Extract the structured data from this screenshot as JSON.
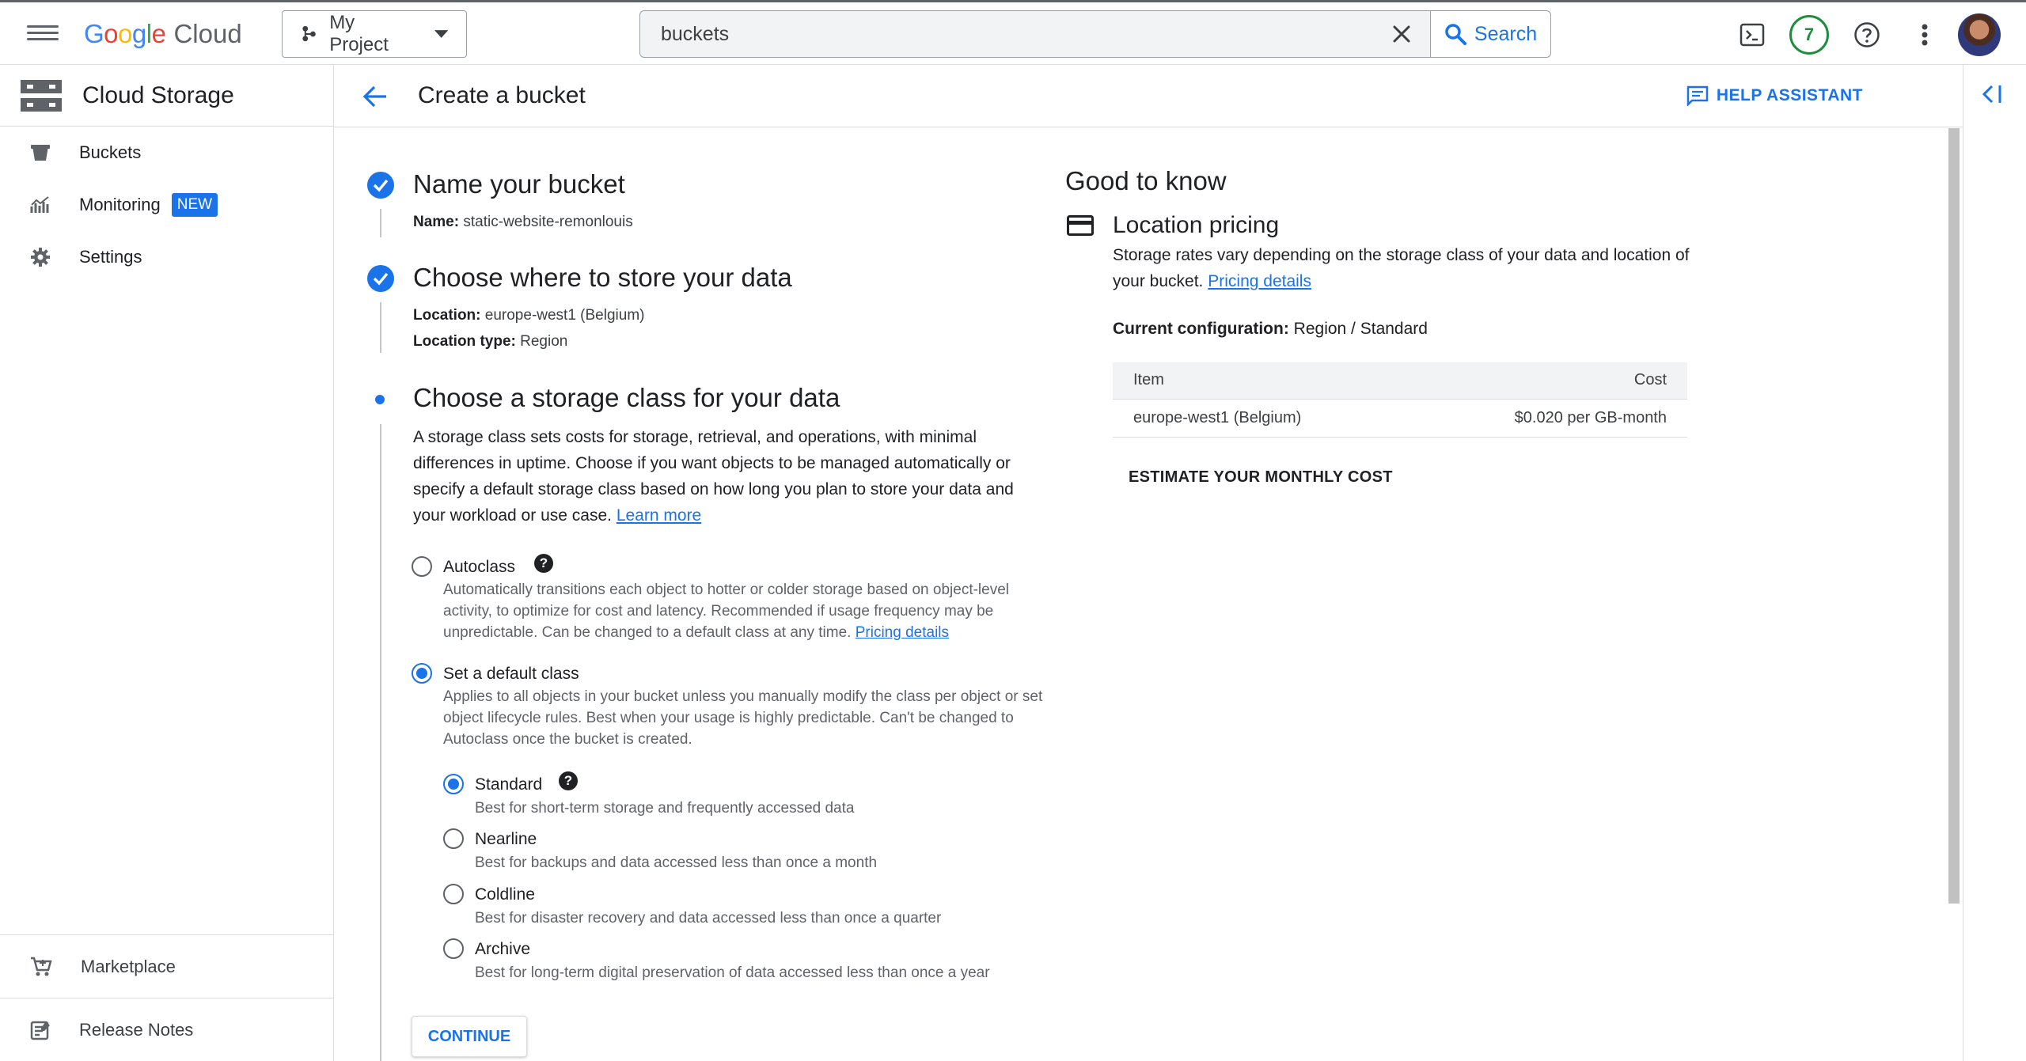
{
  "topbar": {
    "logo_google": "Google",
    "logo_cloud": "Cloud",
    "project_label": "My Project",
    "search_value": "buckets",
    "search_button": "Search",
    "notification_count": "7",
    "logo_colors": [
      "#4285f4",
      "#ea4335",
      "#fbbc05",
      "#4285f4",
      "#34a853",
      "#ea4335"
    ]
  },
  "sidebar": {
    "title": "Cloud Storage",
    "items": [
      {
        "label": "Buckets",
        "icon": "bucket-icon"
      },
      {
        "label": "Monitoring",
        "icon": "monitoring-icon",
        "badge": "NEW"
      },
      {
        "label": "Settings",
        "icon": "gear-icon"
      }
    ],
    "bottom_items": [
      {
        "label": "Marketplace",
        "icon": "cart-icon"
      },
      {
        "label": "Release Notes",
        "icon": "release-notes-icon"
      }
    ]
  },
  "header": {
    "title": "Create a bucket",
    "help_assistant": "HELP ASSISTANT"
  },
  "steps": {
    "step1": {
      "title": "Name your bucket",
      "name_label": "Name:",
      "name_value": "static-website-remonlouis"
    },
    "step2": {
      "title": "Choose where to store your data",
      "location_label": "Location:",
      "location_value": "europe-west1 (Belgium)",
      "location_type_label": "Location type:",
      "location_type_value": "Region"
    },
    "step3": {
      "title": "Choose a storage class for your data",
      "description": "A storage class sets costs for storage, retrieval, and operations, with minimal differences in uptime. Choose if you want objects to be managed automatically or specify a default storage class based on how long you plan to store your data and your workload or use case.",
      "learn_more": "Learn more",
      "autoclass": {
        "label": "Autoclass",
        "description": "Automatically transitions each object to hotter or colder storage based on object-level activity, to optimize for cost and latency. Recommended if usage frequency may be unpredictable. Can be changed to a default class at any time.",
        "pricing_link": "Pricing details",
        "selected": false
      },
      "default_class": {
        "label": "Set a default class",
        "description": "Applies to all objects in your bucket unless you manually modify the class per object or set object lifecycle rules. Best when your usage is highly predictable. Can't be changed to Autoclass once the bucket is created.",
        "selected": true
      },
      "classes": [
        {
          "label": "Standard",
          "description": "Best for short-term storage and frequently accessed data",
          "selected": true
        },
        {
          "label": "Nearline",
          "description": "Best for backups and data accessed less than once a month",
          "selected": false
        },
        {
          "label": "Coldline",
          "description": "Best for disaster recovery and data accessed less than once a quarter",
          "selected": false
        },
        {
          "label": "Archive",
          "description": "Best for long-term digital preservation of data accessed less than once a year",
          "selected": false
        }
      ],
      "continue": "CONTINUE"
    }
  },
  "good_to_know": {
    "title": "Good to know",
    "subtitle": "Location pricing",
    "description": "Storage rates vary depending on the storage class of your data and location of your bucket.",
    "pricing_link": "Pricing details",
    "config_label": "Current configuration:",
    "config_value": "Region / Standard",
    "table": {
      "headers": [
        "Item",
        "Cost"
      ],
      "rows": [
        [
          "europe-west1 (Belgium)",
          "$0.020 per GB-month"
        ]
      ]
    },
    "estimate": "ESTIMATE YOUR MONTHLY COST"
  },
  "colors": {
    "accent": "#1a73e8",
    "success": "#1e8e3e",
    "border": "#dadce0"
  }
}
